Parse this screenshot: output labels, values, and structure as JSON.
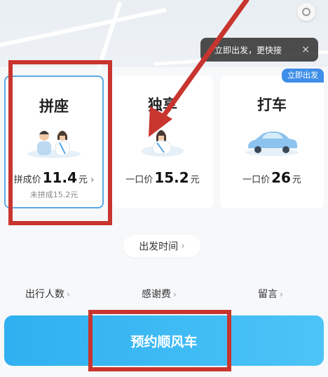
{
  "map": {
    "tooltip_text": "立即出发，更快接",
    "tooltip_close": "×"
  },
  "cards": [
    {
      "title": "拼座",
      "price_prefix": "拼成价",
      "price_value": "11.4",
      "price_unit": "元",
      "price_arrow": "›",
      "sub": "未拼成15.2元",
      "selected": true
    },
    {
      "title": "独享",
      "price_prefix": "一口价",
      "price_value": "15.2",
      "price_unit": "元"
    },
    {
      "title": "打车",
      "price_prefix": "一口价",
      "price_value": "26",
      "price_unit": "元",
      "badge": "立即出发"
    }
  ],
  "depart_time": {
    "label": "出发时间",
    "arrow": "›"
  },
  "options": [
    {
      "label": "出行人数",
      "arrow": "›"
    },
    {
      "label": "感谢费",
      "arrow": "›"
    },
    {
      "label": "留言",
      "arrow": "›"
    }
  ],
  "cta": {
    "label": "预约顺风车"
  },
  "colors": {
    "accent": "#3f8ee8",
    "cta_start": "#2fb0f0",
    "cta_end": "#4cc4f7",
    "selected_border": "#5aa9e6",
    "annotation_red": "#c8352e"
  },
  "icons": {
    "close": "close-icon",
    "chevron": "chevron-right-icon",
    "location": "location-icon"
  }
}
